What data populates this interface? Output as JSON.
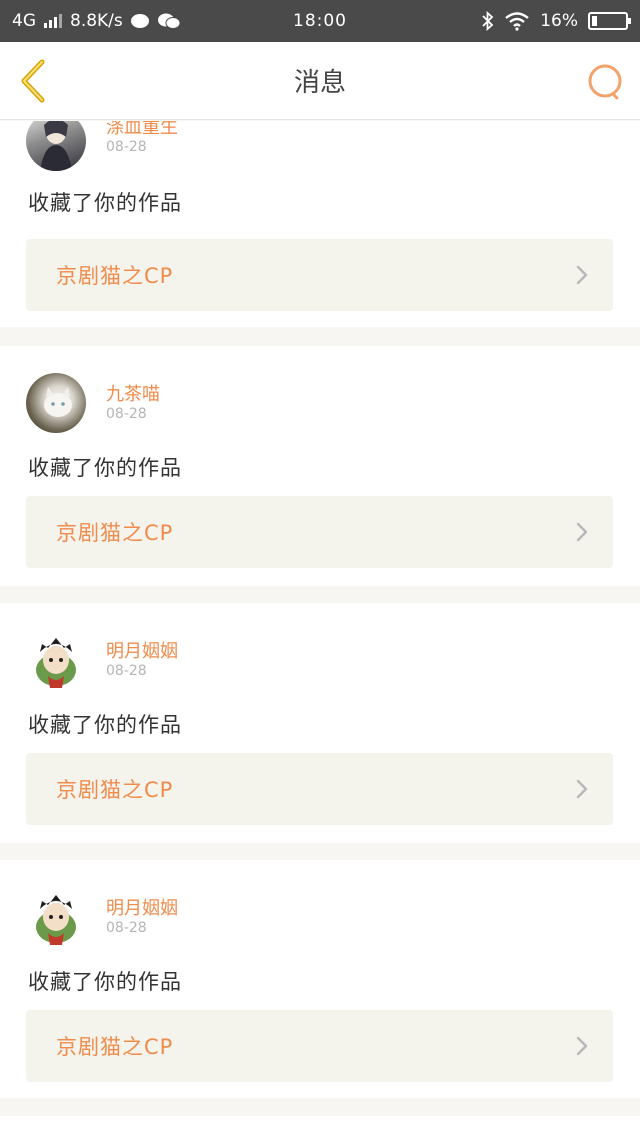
{
  "status_bar": {
    "network": "4G",
    "speed": "8.8K/s",
    "time": "18:00",
    "battery": "16%",
    "battery_level": 0.16
  },
  "header": {
    "title": "消息",
    "back_icon": "chevron-left-icon",
    "search_icon": "search-icon"
  },
  "colors": {
    "accent": "#ef8c4c",
    "back_icon": "#d8a300",
    "link_bg": "#f4f3ec"
  },
  "messages": [
    {
      "user": "涤血重生",
      "date": "08-28",
      "action": "收藏了你的作品",
      "work": "京剧猫之CP"
    },
    {
      "user": "九茶喵",
      "date": "08-28",
      "action": "收藏了你的作品",
      "work": "京剧猫之CP"
    },
    {
      "user": "明月姻姻",
      "date": "08-28",
      "action": "收藏了你的作品",
      "work": "京剧猫之CP"
    },
    {
      "user": "明月姻姻",
      "date": "08-28",
      "action": "收藏了你的作品",
      "work": "京剧猫之CP"
    }
  ]
}
